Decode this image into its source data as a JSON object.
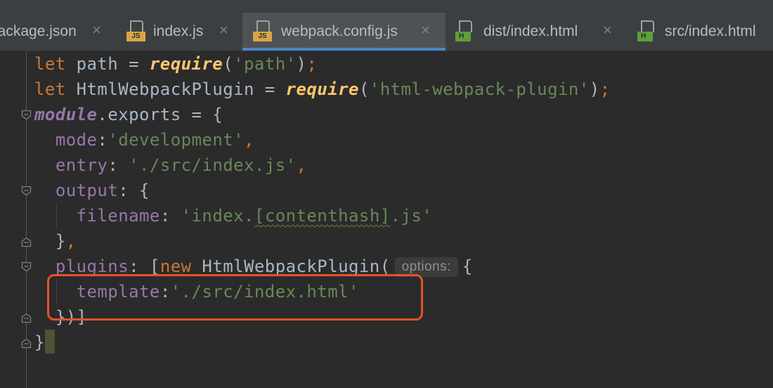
{
  "tabs": [
    {
      "label": "package.json",
      "icon": "json-file-icon",
      "active": false
    },
    {
      "label": "index.js",
      "icon": "js-file-icon",
      "active": false
    },
    {
      "label": "webpack.config.js",
      "icon": "js-file-icon",
      "active": true
    },
    {
      "label": "dist/index.html",
      "icon": "html-file-icon",
      "active": false
    },
    {
      "label": "src/index.html",
      "icon": "html-file-icon",
      "active": false
    }
  ],
  "icons": {
    "js_tag": "JS",
    "html_tag": "H",
    "close": "×"
  },
  "code": {
    "l1": {
      "kw": "let",
      "id": " path = ",
      "fn": "require",
      "p1": "(",
      "str": "'path'",
      "p2": ")",
      "semi": ";"
    },
    "l2": {
      "kw": "let",
      "id": " HtmlWebpackPlugin = ",
      "fn": "require",
      "p1": "(",
      "str": "'html-webpack-plugin'",
      "p2": ")",
      "semi": ";"
    },
    "l3": {
      "mod": "module",
      "rest": ".exports = {"
    },
    "l4": {
      "prop": "mode",
      "colon": ":",
      "str": "'development'",
      "comma": ","
    },
    "l5": {
      "prop": "entry",
      "colon": ": ",
      "str": "'./src/index.js'",
      "comma": ","
    },
    "l6": {
      "prop": "output",
      "rest": ": {"
    },
    "l7": {
      "prop": "filename",
      "colon": ": ",
      "str_a": "'index.",
      "str_b": "[contenthash]",
      "str_c": ".js'"
    },
    "l8": {
      "rest": "}",
      "comma": ","
    },
    "l9": {
      "prop": "plugins",
      "colon": ": [",
      "kw": "new",
      "cls": " HtmlWebpackPlugin(",
      "hint": "options:",
      "brace": "{"
    },
    "l10": {
      "prop": "template",
      "colon": ":",
      "str": "'./src/index.html'"
    },
    "l11": {
      "rest": "})]"
    },
    "l12": {
      "rest": "}"
    }
  },
  "colors": {
    "keyword": "#cc7832",
    "string": "#6a8759",
    "property": "#9876aa",
    "function": "#ffc66d",
    "text": "#a9b7c6",
    "highlight_box": "#e8512b",
    "active_tab_underline": "#4a88c7"
  }
}
